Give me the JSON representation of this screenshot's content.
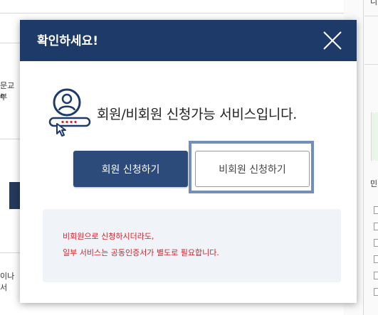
{
  "background": {
    "fragment_left_1": "문교부",
    "fragment_left_2": "e",
    "fragment_left_3": "이나 서",
    "fragment_right_top": "니",
    "fragment_right_mid": "민"
  },
  "modal": {
    "title": "확인하세요!",
    "close_icon": "close-icon",
    "illustration_icon": "user-password-icon",
    "headline": "회원/비회원 신청가능 서비스입니다.",
    "member_button_label": "회원 신청하기",
    "guest_button_label": "비회원 신청하기",
    "notice_lines": [
      "비회원으로 신청하시더라도,",
      "일부 서비스는 공동인증서가 별도로 필요합니다."
    ]
  },
  "colors": {
    "header_bg": "#1e3a68",
    "member_button_bg": "#2c4a7a",
    "focus_ring": "#7190b9",
    "notice_bg": "#f0f3f8",
    "notice_text": "#d1232a",
    "icon_navy": "#1e3a68",
    "icon_red": "#d1232a"
  }
}
